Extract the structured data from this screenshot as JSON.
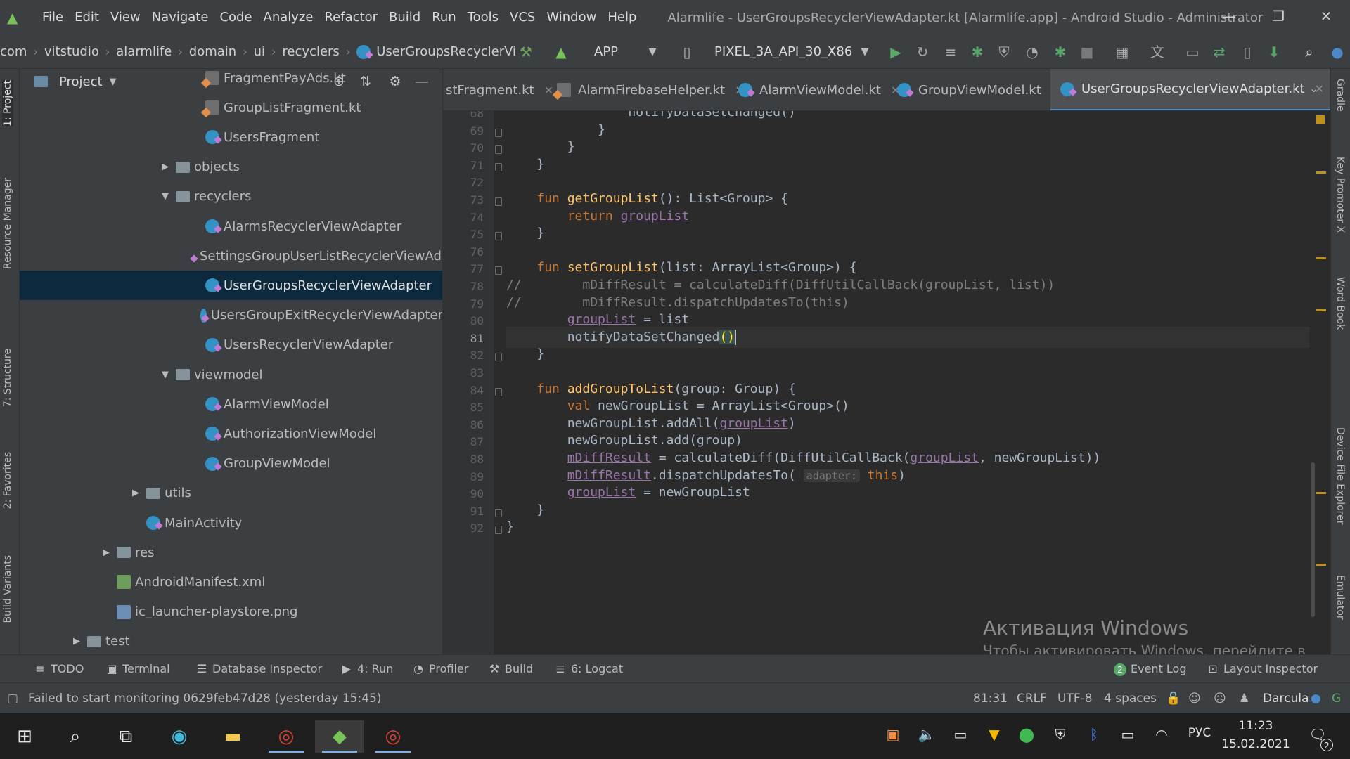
{
  "window": {
    "title": "Alarmlife - UserGroupsRecyclerViewAdapter.kt [Alarmlife.app] - Android Studio - Administrator",
    "menu": [
      "File",
      "Edit",
      "View",
      "Navigate",
      "Code",
      "Analyze",
      "Refactor",
      "Build",
      "Run",
      "Tools",
      "VCS",
      "Window",
      "Help"
    ],
    "controls": {
      "minimize": "—",
      "maximize": "❐",
      "close": "✕"
    }
  },
  "breadcrumb": [
    "com",
    "vitstudio",
    "alarmlife",
    "domain",
    "ui",
    "recyclers",
    "UserGroupsRecyclerViewA"
  ],
  "toolbar": {
    "run_config": "APP",
    "device": "PIXEL_3A_API_30_X86"
  },
  "left_tabs": [
    "1: Project",
    "Resource Manager",
    "7: Structure",
    "2: Favorites",
    "Build Variants"
  ],
  "right_tabs": [
    "Gradle",
    "Key Promoter X",
    "Word Book",
    "Device File Explorer",
    "Emulator"
  ],
  "project": {
    "title": "Project",
    "tree": [
      {
        "label": "FragmentPayAds.kt",
        "indent": 3,
        "icon": "ktfile",
        "arrow": ""
      },
      {
        "label": "GroupListFragment.kt",
        "indent": 3,
        "icon": "ktfile",
        "arrow": ""
      },
      {
        "label": "UsersFragment",
        "indent": 3,
        "icon": "kt",
        "arrow": ""
      },
      {
        "label": "objects",
        "indent": 2,
        "icon": "folder",
        "arrow": "▶"
      },
      {
        "label": "recyclers",
        "indent": 2,
        "icon": "folder",
        "arrow": "▼"
      },
      {
        "label": "AlarmsRecyclerViewAdapter",
        "indent": 3,
        "icon": "kt",
        "arrow": ""
      },
      {
        "label": "SettingsGroupUserListRecyclerViewAdapte",
        "indent": 3,
        "icon": "kt",
        "arrow": ""
      },
      {
        "label": "UserGroupsRecyclerViewAdapter",
        "indent": 3,
        "icon": "kt",
        "arrow": "",
        "selected": true
      },
      {
        "label": "UsersGroupExitRecyclerViewAdapter",
        "indent": 3,
        "icon": "kt",
        "arrow": ""
      },
      {
        "label": "UsersRecyclerViewAdapter",
        "indent": 3,
        "icon": "kt",
        "arrow": ""
      },
      {
        "label": "viewmodel",
        "indent": 2,
        "icon": "folder",
        "arrow": "▼"
      },
      {
        "label": "AlarmViewModel",
        "indent": 3,
        "icon": "kt",
        "arrow": ""
      },
      {
        "label": "AuthorizationViewModel",
        "indent": 3,
        "icon": "kt",
        "arrow": ""
      },
      {
        "label": "GroupViewModel",
        "indent": 3,
        "icon": "kt",
        "arrow": ""
      },
      {
        "label": "utils",
        "indent": 1,
        "icon": "folder",
        "arrow": "▶"
      },
      {
        "label": "MainActivity",
        "indent": 1,
        "icon": "kt",
        "arrow": ""
      },
      {
        "label": "res",
        "indent": 0,
        "icon": "folder",
        "arrow": "▶"
      },
      {
        "label": "AndroidManifest.xml",
        "indent": 0,
        "icon": "xml",
        "arrow": ""
      },
      {
        "label": "ic_launcher-playstore.png",
        "indent": 0,
        "icon": "png",
        "arrow": ""
      },
      {
        "label": "test",
        "indent": -1,
        "icon": "folder",
        "arrow": "▶"
      }
    ]
  },
  "tabs": [
    {
      "label": "stFragment.kt",
      "icon": "ktfile"
    },
    {
      "label": "AlarmFirebaseHelper.kt",
      "icon": "ktfile"
    },
    {
      "label": "AlarmViewModel.kt",
      "icon": "kt"
    },
    {
      "label": "GroupViewModel.kt",
      "icon": "kt"
    },
    {
      "label": "UserGroupsRecyclerViewAdapter.kt",
      "icon": "kt",
      "active": true
    }
  ],
  "editor": {
    "current_line": 81,
    "lines": [
      {
        "n": 68,
        "html": "                <span class=\"fn-plain\">notifyDataSetChanged</span>()"
      },
      {
        "n": 69,
        "html": "            }"
      },
      {
        "n": 70,
        "html": "        }"
      },
      {
        "n": 71,
        "html": "    }"
      },
      {
        "n": 72,
        "html": ""
      },
      {
        "n": 73,
        "html": "    <span class=\"kw\">fun</span> <span class=\"fn\">getGroupList</span>(): List&lt;Group&gt; {"
      },
      {
        "n": 74,
        "html": "        <span class=\"kw\">return</span> <span class=\"prop\">groupList</span>"
      },
      {
        "n": 75,
        "html": "    }"
      },
      {
        "n": 76,
        "html": ""
      },
      {
        "n": 77,
        "html": "    <span class=\"kw\">fun</span> <span class=\"fn\">setGroupList</span>(list: ArrayList&lt;Group&gt;) {"
      },
      {
        "n": 78,
        "html": "<span class=\"cm\">//        mDiffResult = calculateDiff(DiffUtilCallBack(groupList, list))</span>"
      },
      {
        "n": 79,
        "html": "<span class=\"cm\">//        mDiffResult.dispatchUpdatesTo(this)</span>"
      },
      {
        "n": 80,
        "html": "        <span class=\"prop\">groupList</span> = list"
      },
      {
        "n": 81,
        "html": "        notifyDataSetChanged<span class=\"paren-match\">()</span><span class=\"caret\"></span>"
      },
      {
        "n": 82,
        "html": "    }"
      },
      {
        "n": 83,
        "html": ""
      },
      {
        "n": 84,
        "html": "    <span class=\"kw\">fun</span> <span class=\"fn\">addGroupToList</span>(group: Group) {"
      },
      {
        "n": 85,
        "html": "        <span class=\"kw\">val</span> newGroupList = ArrayList&lt;Group&gt;()"
      },
      {
        "n": 86,
        "html": "        newGroupList.addAll(<span class=\"prop\">groupList</span>)"
      },
      {
        "n": 87,
        "html": "        newGroupList.add(group)"
      },
      {
        "n": 88,
        "html": "        <span class=\"prop\">mDiffResult</span> = calculateDiff(DiffUtilCallBack(<span class=\"prop\">groupList</span>, newGroupList))"
      },
      {
        "n": 89,
        "html": "        <span class=\"prop\">mDiffResult</span>.dispatchUpdatesTo( <span class=\"hint\">adapter:</span> <span class=\"kw\">this</span>)"
      },
      {
        "n": 90,
        "html": "        <span class=\"prop\">groupList</span> = newGroupList"
      },
      {
        "n": 91,
        "html": "    }"
      },
      {
        "n": 92,
        "html": "}"
      }
    ]
  },
  "watermark": {
    "title": "Активация Windows",
    "text": "Чтобы активировать Windows, перейдите в раздел \"Параметры\"."
  },
  "bottom_tools": [
    "TODO",
    "Terminal",
    "Database Inspector",
    "4: Run",
    "Profiler",
    "Build",
    "6: Logcat",
    "Event Log",
    "Layout Inspector"
  ],
  "event_log_count": "2",
  "status": {
    "message": "Failed to start monitoring 0629feb47d28 (yesterday 15:45)",
    "position": "81:31",
    "line_sep": "CRLF",
    "encoding": "UTF-8",
    "indent": "4 spaces",
    "theme": "Darcula"
  },
  "taskbar": {
    "lang": "РУС",
    "time": "11:23",
    "date": "15.02.2021",
    "notif_count": "2"
  }
}
